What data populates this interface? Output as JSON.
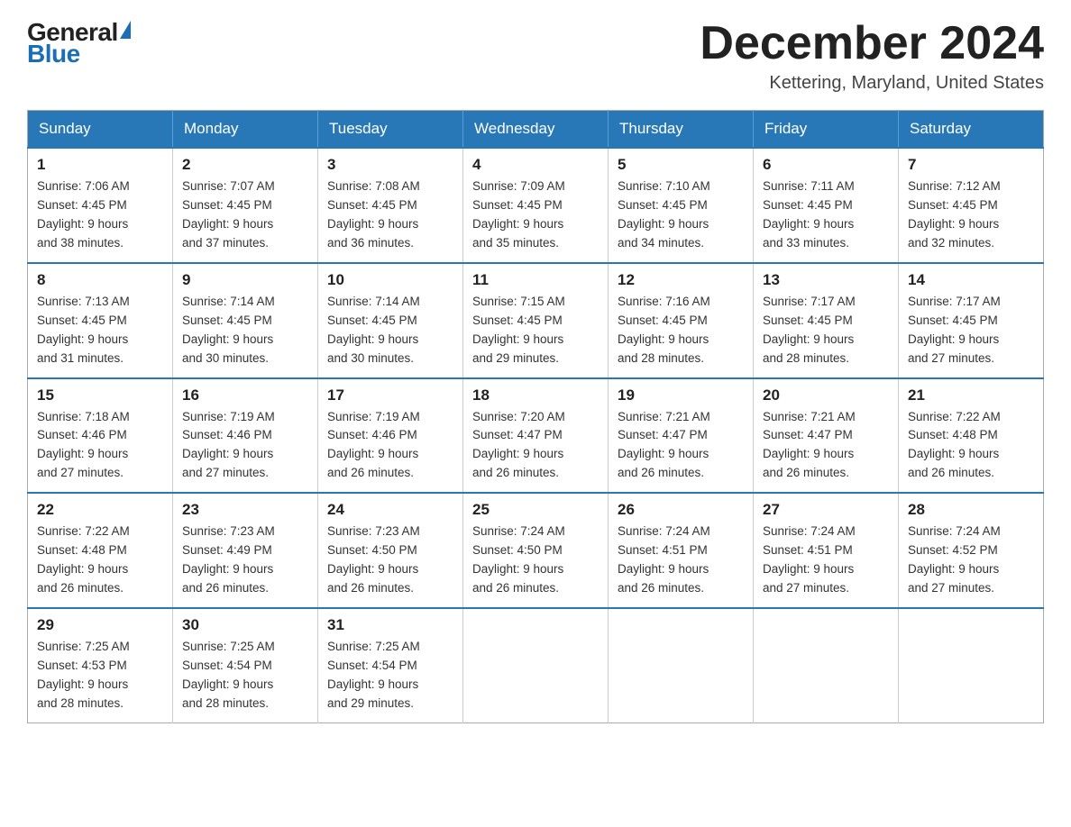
{
  "header": {
    "logo_general": "General",
    "logo_blue": "Blue",
    "month_title": "December 2024",
    "location": "Kettering, Maryland, United States"
  },
  "days_of_week": [
    "Sunday",
    "Monday",
    "Tuesday",
    "Wednesday",
    "Thursday",
    "Friday",
    "Saturday"
  ],
  "weeks": [
    [
      {
        "day": "1",
        "sunrise": "7:06 AM",
        "sunset": "4:45 PM",
        "daylight": "9 hours and 38 minutes."
      },
      {
        "day": "2",
        "sunrise": "7:07 AM",
        "sunset": "4:45 PM",
        "daylight": "9 hours and 37 minutes."
      },
      {
        "day": "3",
        "sunrise": "7:08 AM",
        "sunset": "4:45 PM",
        "daylight": "9 hours and 36 minutes."
      },
      {
        "day": "4",
        "sunrise": "7:09 AM",
        "sunset": "4:45 PM",
        "daylight": "9 hours and 35 minutes."
      },
      {
        "day": "5",
        "sunrise": "7:10 AM",
        "sunset": "4:45 PM",
        "daylight": "9 hours and 34 minutes."
      },
      {
        "day": "6",
        "sunrise": "7:11 AM",
        "sunset": "4:45 PM",
        "daylight": "9 hours and 33 minutes."
      },
      {
        "day": "7",
        "sunrise": "7:12 AM",
        "sunset": "4:45 PM",
        "daylight": "9 hours and 32 minutes."
      }
    ],
    [
      {
        "day": "8",
        "sunrise": "7:13 AM",
        "sunset": "4:45 PM",
        "daylight": "9 hours and 31 minutes."
      },
      {
        "day": "9",
        "sunrise": "7:14 AM",
        "sunset": "4:45 PM",
        "daylight": "9 hours and 30 minutes."
      },
      {
        "day": "10",
        "sunrise": "7:14 AM",
        "sunset": "4:45 PM",
        "daylight": "9 hours and 30 minutes."
      },
      {
        "day": "11",
        "sunrise": "7:15 AM",
        "sunset": "4:45 PM",
        "daylight": "9 hours and 29 minutes."
      },
      {
        "day": "12",
        "sunrise": "7:16 AM",
        "sunset": "4:45 PM",
        "daylight": "9 hours and 28 minutes."
      },
      {
        "day": "13",
        "sunrise": "7:17 AM",
        "sunset": "4:45 PM",
        "daylight": "9 hours and 28 minutes."
      },
      {
        "day": "14",
        "sunrise": "7:17 AM",
        "sunset": "4:45 PM",
        "daylight": "9 hours and 27 minutes."
      }
    ],
    [
      {
        "day": "15",
        "sunrise": "7:18 AM",
        "sunset": "4:46 PM",
        "daylight": "9 hours and 27 minutes."
      },
      {
        "day": "16",
        "sunrise": "7:19 AM",
        "sunset": "4:46 PM",
        "daylight": "9 hours and 27 minutes."
      },
      {
        "day": "17",
        "sunrise": "7:19 AM",
        "sunset": "4:46 PM",
        "daylight": "9 hours and 26 minutes."
      },
      {
        "day": "18",
        "sunrise": "7:20 AM",
        "sunset": "4:47 PM",
        "daylight": "9 hours and 26 minutes."
      },
      {
        "day": "19",
        "sunrise": "7:21 AM",
        "sunset": "4:47 PM",
        "daylight": "9 hours and 26 minutes."
      },
      {
        "day": "20",
        "sunrise": "7:21 AM",
        "sunset": "4:47 PM",
        "daylight": "9 hours and 26 minutes."
      },
      {
        "day": "21",
        "sunrise": "7:22 AM",
        "sunset": "4:48 PM",
        "daylight": "9 hours and 26 minutes."
      }
    ],
    [
      {
        "day": "22",
        "sunrise": "7:22 AM",
        "sunset": "4:48 PM",
        "daylight": "9 hours and 26 minutes."
      },
      {
        "day": "23",
        "sunrise": "7:23 AM",
        "sunset": "4:49 PM",
        "daylight": "9 hours and 26 minutes."
      },
      {
        "day": "24",
        "sunrise": "7:23 AM",
        "sunset": "4:50 PM",
        "daylight": "9 hours and 26 minutes."
      },
      {
        "day": "25",
        "sunrise": "7:24 AM",
        "sunset": "4:50 PM",
        "daylight": "9 hours and 26 minutes."
      },
      {
        "day": "26",
        "sunrise": "7:24 AM",
        "sunset": "4:51 PM",
        "daylight": "9 hours and 26 minutes."
      },
      {
        "day": "27",
        "sunrise": "7:24 AM",
        "sunset": "4:51 PM",
        "daylight": "9 hours and 27 minutes."
      },
      {
        "day": "28",
        "sunrise": "7:24 AM",
        "sunset": "4:52 PM",
        "daylight": "9 hours and 27 minutes."
      }
    ],
    [
      {
        "day": "29",
        "sunrise": "7:25 AM",
        "sunset": "4:53 PM",
        "daylight": "9 hours and 28 minutes."
      },
      {
        "day": "30",
        "sunrise": "7:25 AM",
        "sunset": "4:54 PM",
        "daylight": "9 hours and 28 minutes."
      },
      {
        "day": "31",
        "sunrise": "7:25 AM",
        "sunset": "4:54 PM",
        "daylight": "9 hours and 29 minutes."
      },
      null,
      null,
      null,
      null
    ]
  ],
  "labels": {
    "sunrise": "Sunrise:",
    "sunset": "Sunset:",
    "daylight": "Daylight:"
  }
}
